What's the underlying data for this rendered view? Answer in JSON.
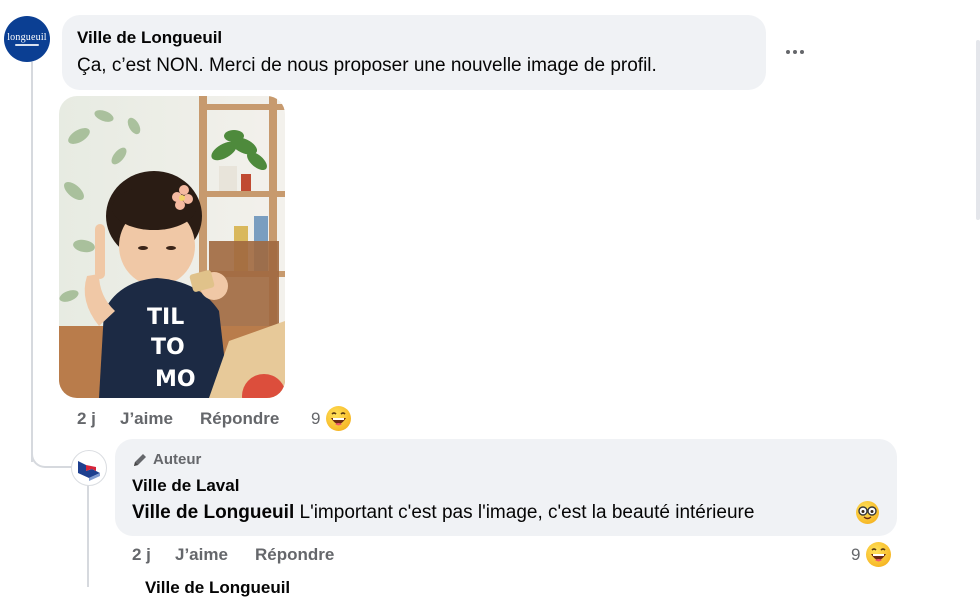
{
  "comment": {
    "author": "Ville de Longueuil",
    "text": "Ça, c’est NON. Merci de nous proposer une nouvelle image de profil.",
    "avatar_logo_text": "longueuil",
    "image": {
      "shirt_text_1": "TIL",
      "shirt_text_2": "TO",
      "shirt_text_3": "MO"
    },
    "actions": {
      "time": "2 j",
      "like_label": "J’aime",
      "reply_label": "Répondre"
    },
    "reaction_count": "9",
    "reaction_icon": "laughing-face-icon",
    "more_icon": "more-options-icon"
  },
  "reply": {
    "badge": "Auteur",
    "badge_icon": "pencil-icon",
    "author": "Ville de Laval",
    "mention": "Ville de Longueuil",
    "text": " L'important c'est pas l'image, c'est la beauté intérieure",
    "trailing_emoji": "nerd-face-icon",
    "actions": {
      "time": "2 j",
      "like_label": "J’aime",
      "reply_label": "Répondre"
    },
    "reaction_count": "9",
    "reaction_icon": "laughing-face-icon"
  },
  "next_comment_author_partial": "Ville de Longueuil",
  "colors": {
    "bubble": "#f0f2f5",
    "secondary_text": "#65676b",
    "longueuil_blue": "#0b3f93",
    "laval_blue": "#1d3f8f",
    "laval_red": "#d6243a"
  }
}
